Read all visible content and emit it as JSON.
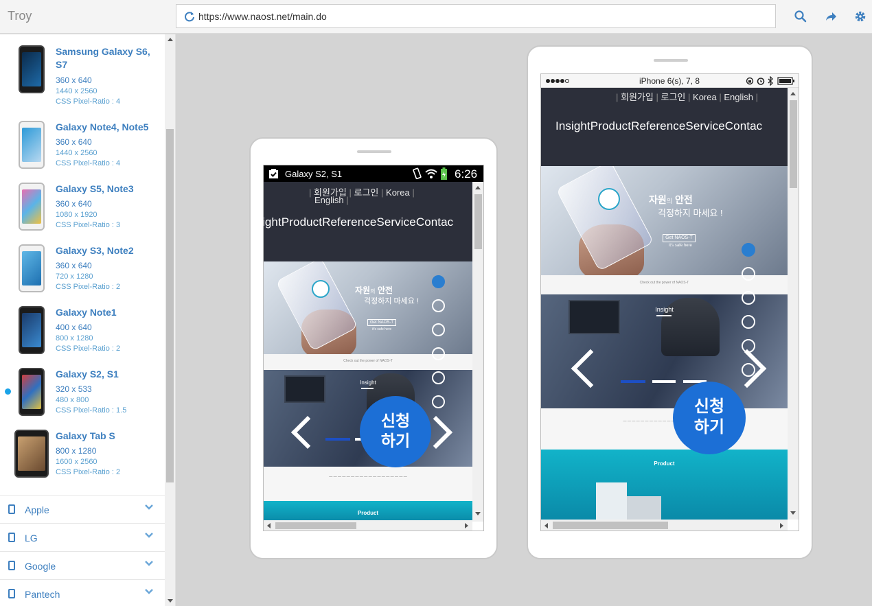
{
  "app": {
    "title": "Troy"
  },
  "urlbar": {
    "url": "https://www.naost.net/main.do"
  },
  "toolbar": {
    "icons": [
      "search-icon",
      "share-icon",
      "gear-icon"
    ]
  },
  "colors": {
    "accent": "#3d7fbf",
    "active_dot": "#1aa3e8",
    "cta": "#1c6fd6",
    "site_header": "#2c2f3a"
  },
  "sidebar": {
    "devices": [
      {
        "name": "Samsung Galaxy S6, S7",
        "res": "360 x 640",
        "physical": "1440 x 2560",
        "ratio": "CSS Pixel-Ratio : 4"
      },
      {
        "name": "Galaxy Note4, Note5",
        "res": "360 x 640",
        "physical": "1440 x 2560",
        "ratio": "CSS Pixel-Ratio : 4"
      },
      {
        "name": "Galaxy S5, Note3",
        "res": "360 x 640",
        "physical": "1080 x 1920",
        "ratio": "CSS Pixel-Ratio : 3"
      },
      {
        "name": "Galaxy S3, Note2",
        "res": "360 x 640",
        "physical": "720 x 1280",
        "ratio": "CSS Pixel-Ratio : 2"
      },
      {
        "name": "Galaxy Note1",
        "res": "400 x 640",
        "physical": "800 x 1280",
        "ratio": "CSS Pixel-Ratio : 2"
      },
      {
        "name": "Galaxy S2, S1",
        "res": "320 x 533",
        "physical": "480 x 800",
        "ratio": "CSS Pixel-Ratio : 1.5"
      },
      {
        "name": "Galaxy Tab S",
        "res": "800 x 1280",
        "physical": "1600 x 2560",
        "ratio": "CSS Pixel-Ratio : 2"
      }
    ],
    "categories": [
      "Apple",
      "LG",
      "Google",
      "Pantech"
    ]
  },
  "galaxy_preview": {
    "device_label": "Galaxy S2, S1",
    "time": "6:26",
    "links": [
      "회원가입",
      "로그인",
      "Korea",
      "English"
    ],
    "nav": "ightProductReferenceServiceContac",
    "hero_title_a": "자원",
    "hero_title_b": "의",
    "hero_title_c": "안전",
    "hero_sub": "걱정하지 마세요 !",
    "hero_btn": "Get NAOS-T",
    "hero_small": "it's safe here",
    "power": "Check out the power of NAOS-T",
    "insight": "Insight",
    "cta": "신청\n하기",
    "product": "Product"
  },
  "iphone_preview": {
    "device_label": "iPhone 6(s), 7, 8",
    "links": [
      "회원가입",
      "로그인",
      "Korea",
      "English"
    ],
    "nav": "InsightProductReferenceServiceContac",
    "hero_title_a": "자원",
    "hero_title_b": "의",
    "hero_title_c": "안전",
    "hero_sub": "걱정하지 마세요 !",
    "hero_btn": "Get NAOS-T",
    "hero_small": "it's safe here",
    "power": "Check out the power of NAOS-T",
    "insight": "Insight",
    "cta": "신청\n하기",
    "product": "Product"
  }
}
